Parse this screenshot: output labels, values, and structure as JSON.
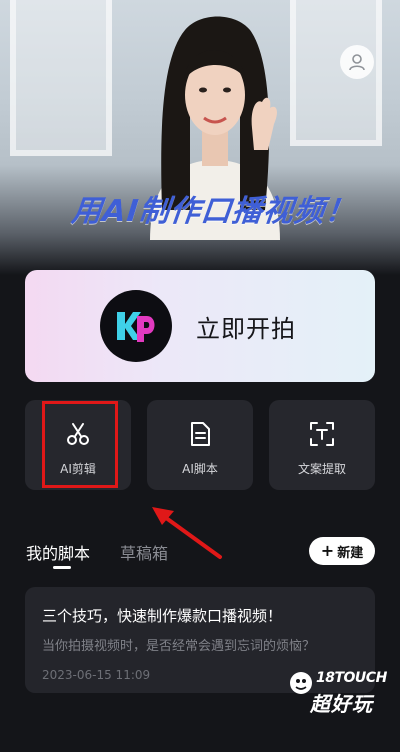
{
  "hero": {
    "title": "用AI制作口播视频！"
  },
  "main_card": {
    "label": "立即开拍",
    "logo_icon": "kp-logo-icon"
  },
  "tools": [
    {
      "label": "AI剪辑",
      "icon": "scissors-icon"
    },
    {
      "label": "AI脚本",
      "icon": "document-icon"
    },
    {
      "label": "文案提取",
      "icon": "text-extract-icon"
    }
  ],
  "tabs": {
    "active": "我的脚本",
    "inactive": "草稿箱"
  },
  "new_button": {
    "label": "新建",
    "icon": "plus-icon"
  },
  "script_item": {
    "title": "三个技巧，快速制作爆款口播视频！",
    "desc": "当你拍摄视频时，是否经常会遇到忘词的烦恼？",
    "date": "2023-06-15 11:09"
  },
  "watermark": {
    "top": "18TOUCH",
    "bottom": "超好玩"
  },
  "colors": {
    "accent_blue": "#3f5fd6",
    "highlight_red": "#e01818",
    "background": "#141519"
  }
}
